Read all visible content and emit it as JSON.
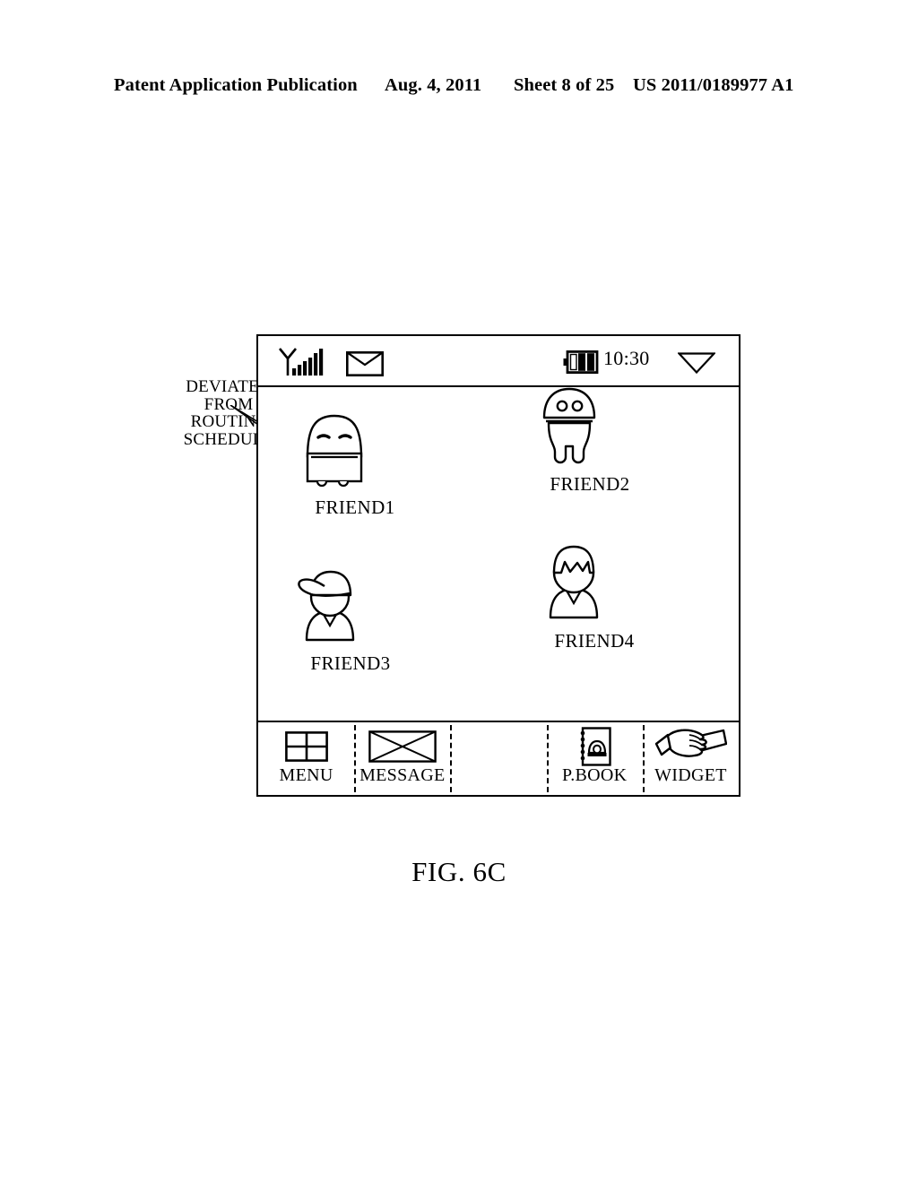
{
  "patent_header": {
    "publication": "Patent Application Publication",
    "date": "Aug. 4, 2011",
    "sheet": "Sheet 8 of 25",
    "number": "US 2011/0189977 A1"
  },
  "callout": {
    "line1": "DEVIATED",
    "line2": "FROM",
    "line3": "ROUTINE",
    "line4": "SCHEDULE",
    "arrow_icon": "lightning-bolt-pointer-icon"
  },
  "phone": {
    "status_bar": {
      "signal_icon": "signal-bars-icon",
      "message_icon": "envelope-icon",
      "battery_icon": "battery-icon",
      "time": "10:30",
      "dropdown_icon": "triangle-down-icon"
    },
    "friends": [
      {
        "label": "FRIEND1",
        "avatar_icon": "sleeping-robot-avatar-icon"
      },
      {
        "label": "FRIEND2",
        "avatar_icon": "dome-head-robot-avatar-icon"
      },
      {
        "label": "FRIEND3",
        "avatar_icon": "person-with-cap-avatar-icon"
      },
      {
        "label": "FRIEND4",
        "avatar_icon": "person-with-bangs-avatar-icon"
      }
    ],
    "toolbar": [
      {
        "label": "MENU",
        "icon": "grid-four-squares-icon"
      },
      {
        "label": "MESSAGE",
        "icon": "envelope-icon"
      },
      {
        "label": "",
        "icon": "empty-icon"
      },
      {
        "label": "P.BOOK",
        "icon": "phone-book-icon"
      },
      {
        "label": "WIDGET",
        "icon": "hand-drag-icon"
      }
    ]
  },
  "figure_caption": "FIG. 6C",
  "colors": {
    "ink": "#000000",
    "paper": "#ffffff"
  }
}
